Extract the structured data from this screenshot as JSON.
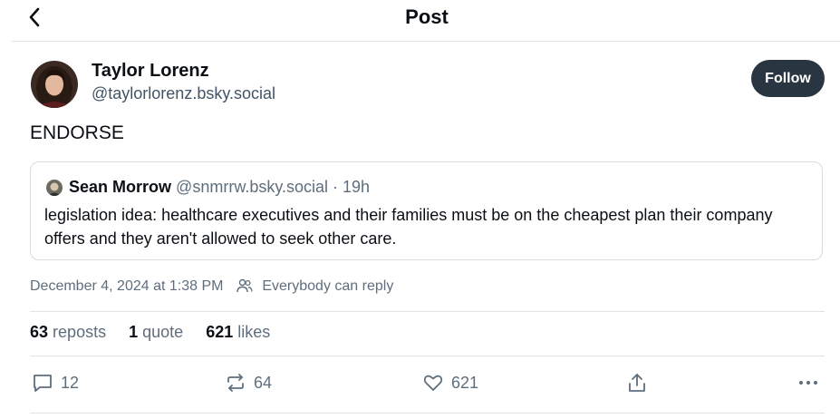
{
  "header": {
    "title": "Post",
    "back_icon": "chevron-left-icon"
  },
  "author": {
    "name": "Taylor Lorenz",
    "handle": "@taylorlorenz.bsky.social",
    "avatar_icon": "avatar",
    "follow_label": "Follow"
  },
  "post": {
    "text": "ENDORSE"
  },
  "quoted_post": {
    "author_name": "Sean Morrow",
    "handle": "@snmrrw.bsky.social",
    "separator": " · ",
    "age": "19h",
    "text": "legislation idea: healthcare executives and their families must be on the cheapest plan their company offers and they aren't allowed to seek other care."
  },
  "meta": {
    "timestamp": "December 4, 2024 at 1:38 PM",
    "reply_setting": "Everybody can reply",
    "reply_icon": "people-icon"
  },
  "stats": {
    "reposts_count": "63",
    "reposts_label": "reposts",
    "quotes_count": "1",
    "quotes_label": "quote",
    "likes_count": "621",
    "likes_label": "likes"
  },
  "actions": {
    "reply_count": "12",
    "repost_count": "64",
    "like_count": "621",
    "icons": [
      "comment-icon",
      "repost-icon",
      "heart-icon",
      "share-icon",
      "more-icon"
    ]
  },
  "colors": {
    "follow_button_bg": "#2a3542",
    "muted_text": "#5f6e7d",
    "divider": "#dfe3e8"
  }
}
